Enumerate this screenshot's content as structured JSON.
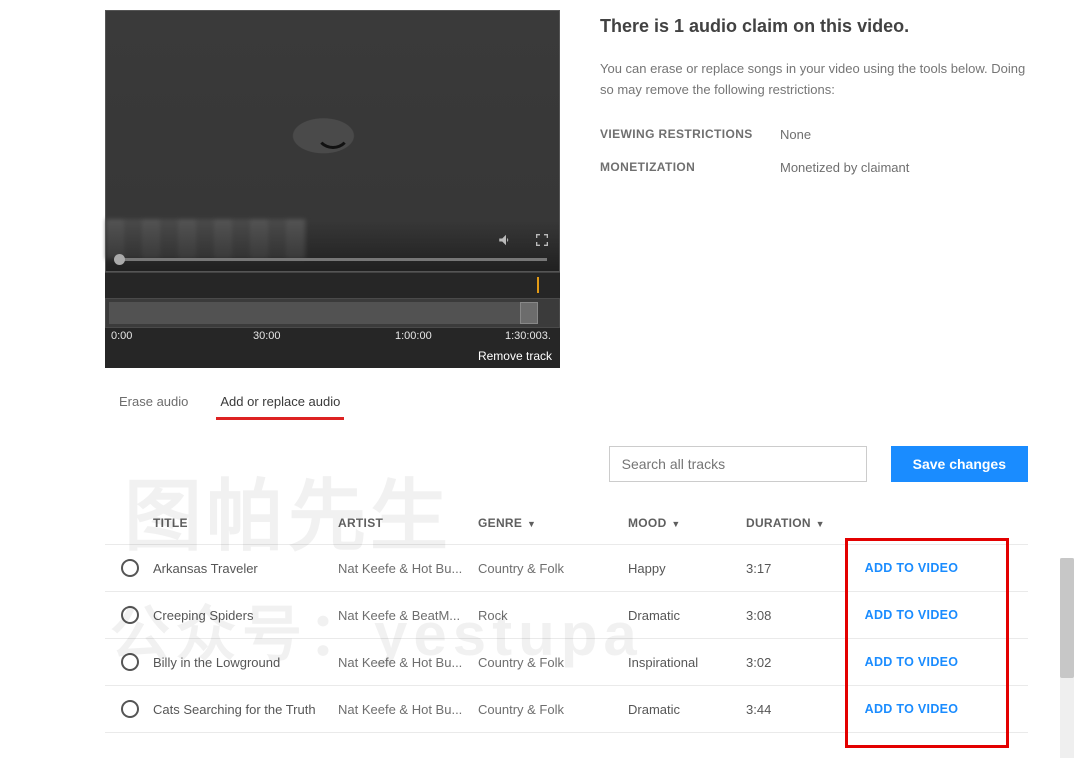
{
  "claim": {
    "title": "There is 1 audio claim on this video.",
    "description": "You can erase or replace songs in your video using the tools below. Doing so may remove the following restrictions:",
    "rows": [
      {
        "label": "VIEWING RESTRICTIONS",
        "value": "None"
      },
      {
        "label": "MONETIZATION",
        "value": "Monetized by claimant"
      }
    ]
  },
  "player": {
    "remove_track_label": "Remove track",
    "ruler": {
      "t0": "0:00",
      "t1": "30:00",
      "t2": "1:00:00",
      "t3": "1:30:003."
    }
  },
  "tabs": {
    "erase": "Erase audio",
    "replace": "Add or replace audio"
  },
  "toolbar": {
    "search_placeholder": "Search all tracks",
    "save_label": "Save changes"
  },
  "table": {
    "headers": {
      "title": "TITLE",
      "artist": "ARTIST",
      "genre": "GENRE",
      "mood": "MOOD",
      "duration": "DURATION",
      "action": "ADD TO VIDEO"
    },
    "rows": [
      {
        "title": "Arkansas Traveler",
        "artist": "Nat Keefe & Hot Bu...",
        "genre": "Country & Folk",
        "mood": "Happy",
        "duration": "3:17"
      },
      {
        "title": "Creeping Spiders",
        "artist": "Nat Keefe & BeatM...",
        "genre": "Rock",
        "mood": "Dramatic",
        "duration": "3:08"
      },
      {
        "title": "Billy in the Lowground",
        "artist": "Nat Keefe & Hot Bu...",
        "genre": "Country & Folk",
        "mood": "Inspirational",
        "duration": "3:02"
      },
      {
        "title": "Cats Searching for the Truth",
        "artist": "Nat Keefe & Hot Bu...",
        "genre": "Country & Folk",
        "mood": "Dramatic",
        "duration": "3:44"
      }
    ]
  },
  "watermark": {
    "line1": "图帕先生",
    "line2": "公众号：yestupa"
  }
}
